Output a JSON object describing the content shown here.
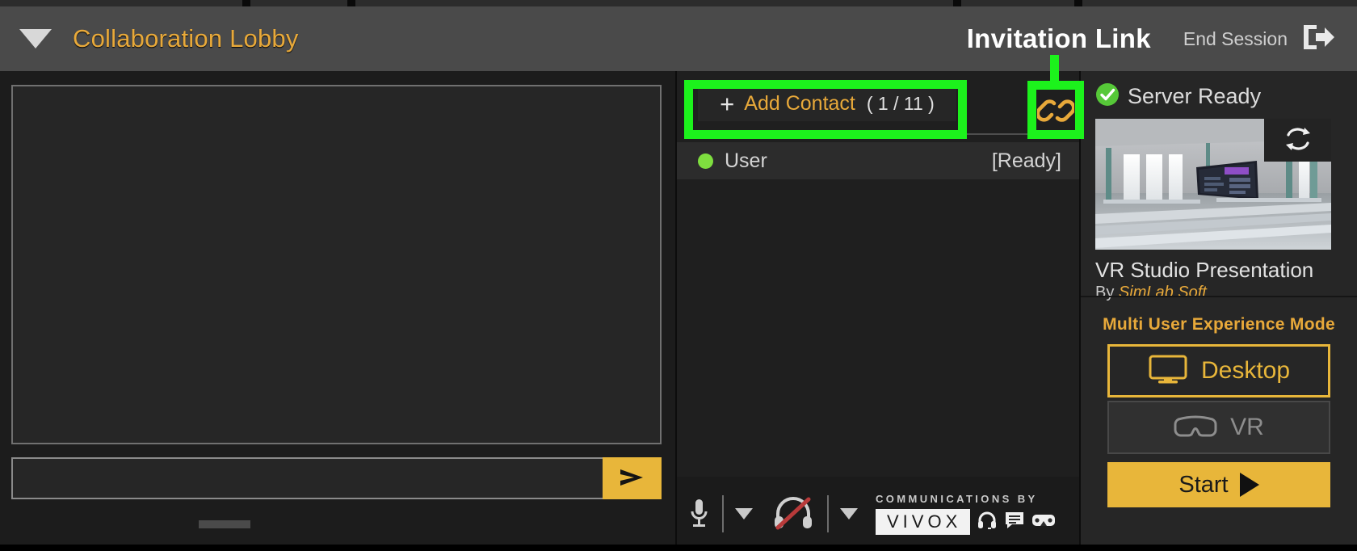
{
  "header": {
    "caret_icon": "caret-down-icon",
    "title": "Collaboration Lobby",
    "annotation_label": "Invitation Link",
    "end_session_label": "End Session",
    "end_session_icon": "exit-door-icon"
  },
  "chat": {
    "log_text": "",
    "input_value": "",
    "input_placeholder": "",
    "send_icon": "send-arrow-icon"
  },
  "contacts": {
    "add_plus": "+",
    "add_label": "Add Contact",
    "add_count": "( 1 / 11 )",
    "rows": [
      {
        "name": "User",
        "state": "[Ready]",
        "status_color": "#7ede3f"
      }
    ]
  },
  "comms": {
    "mic_icon": "microphone-icon",
    "mic_caret_icon": "caret-down-icon",
    "headset_icon": "headset-muted-icon",
    "headset_caret_icon": "caret-down-icon",
    "communications_by": "COMMUNICATIONS BY",
    "vivox_logo": "VIVOX",
    "trailing_icons": [
      "headset-icon",
      "chat-bubble-icon",
      "vr-headset-icon"
    ]
  },
  "right": {
    "server_status_icon": "check-circle-icon",
    "server_status": "Server Ready",
    "refresh_icon": "refresh-icon",
    "experience_title": "VR Studio Presentation",
    "by_prefix": "By",
    "by_author": "SimLab Soft",
    "mode_title": "Multi User Experience Mode",
    "modes": [
      {
        "label": "Desktop",
        "icon": "monitor-icon",
        "selected": true
      },
      {
        "label": "VR",
        "icon": "vr-headset-icon",
        "selected": false
      }
    ],
    "start_label": "Start",
    "start_icon": "play-triangle-icon"
  },
  "colors": {
    "accent": "#e8b63a",
    "accent_text": "#e8a93a",
    "annotation_green": "#1cf21c",
    "status_green": "#7ede3f",
    "panel_bg": "#1f1f1f",
    "header_bg": "#4a4a4a"
  }
}
